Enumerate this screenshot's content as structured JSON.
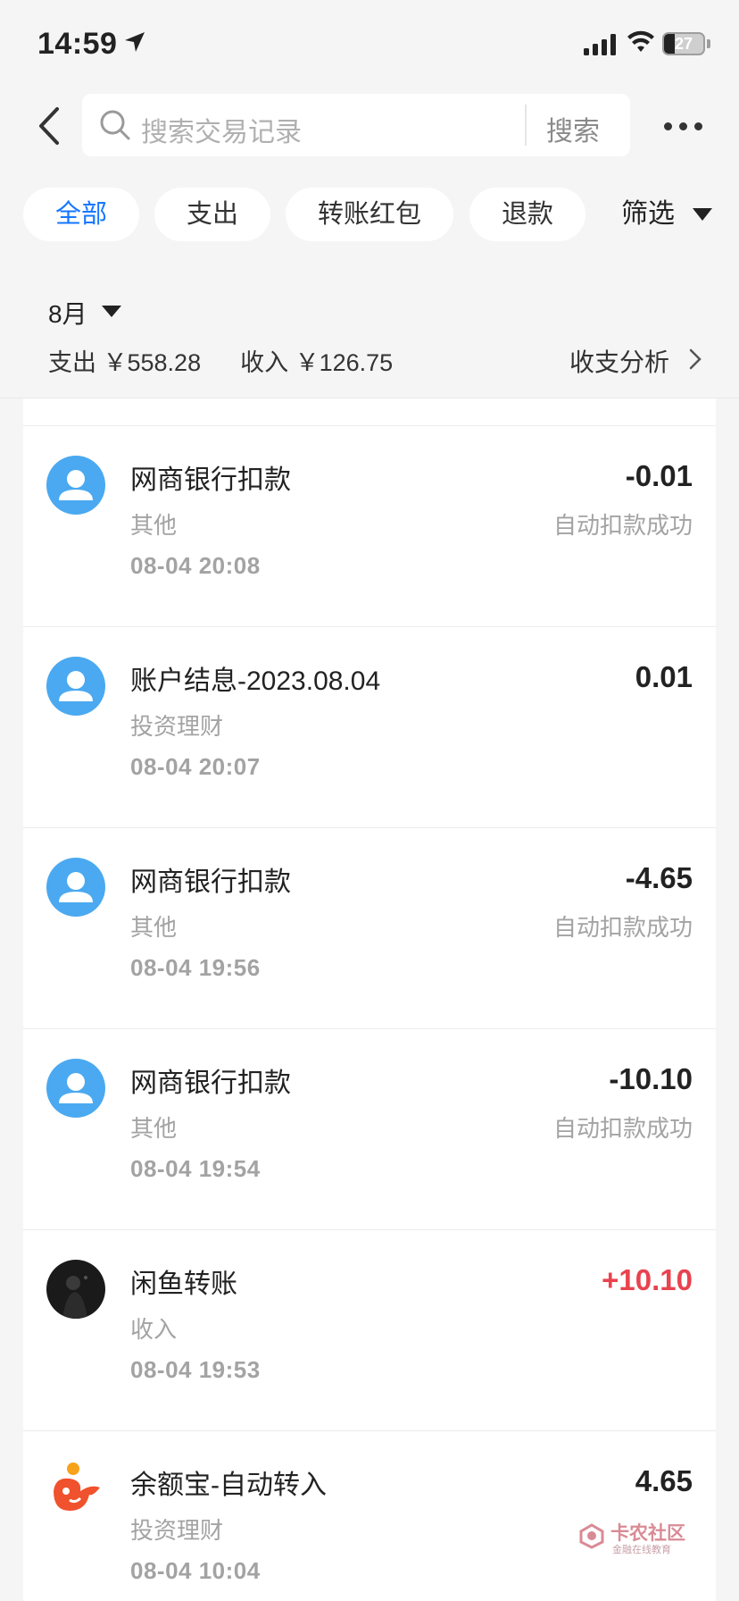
{
  "status_bar": {
    "time": "14:59",
    "battery": "27",
    "battery_level": 0.27
  },
  "header": {
    "search_placeholder": "搜索交易记录",
    "search_button": "搜索"
  },
  "filters": {
    "chips": [
      "全部",
      "支出",
      "转账红包",
      "退款"
    ],
    "active": "全部",
    "filter_label": "筛选"
  },
  "summary": {
    "month": "8月",
    "expense": "支出 ￥558.28",
    "income": "收入 ￥126.75",
    "analysis": "收支分析"
  },
  "transactions": [
    {
      "title": "网商银行扣款",
      "category": "其他",
      "time": "08-04 20:08",
      "amount": "-0.01",
      "status": "自动扣款成功",
      "avatar": "default-user"
    },
    {
      "title": "账户结息-2023.08.04",
      "category": "投资理财",
      "time": "08-04 20:07",
      "amount": "0.01",
      "status": "",
      "avatar": "default-user"
    },
    {
      "title": "网商银行扣款",
      "category": "其他",
      "time": "08-04 19:56",
      "amount": "-4.65",
      "status": "自动扣款成功",
      "avatar": "default-user"
    },
    {
      "title": "网商银行扣款",
      "category": "其他",
      "time": "08-04 19:54",
      "amount": "-10.10",
      "status": "自动扣款成功",
      "avatar": "default-user"
    },
    {
      "title": "闲鱼转账",
      "category": "收入",
      "time": "08-04 19:53",
      "amount": "+10.10",
      "status": "",
      "avatar": "photo-dark"
    },
    {
      "title": "余额宝-自动转入",
      "category": "投资理财",
      "time": "08-04 10:04",
      "amount": "4.65",
      "status": "",
      "avatar": "yuebao-logo"
    }
  ],
  "watermark": {
    "title": "卡农社区",
    "subtitle": "金融在线教育"
  },
  "colors": {
    "accent": "#1677ff",
    "income": "#e8434f",
    "avatar_blue": "#4aa9f0"
  }
}
